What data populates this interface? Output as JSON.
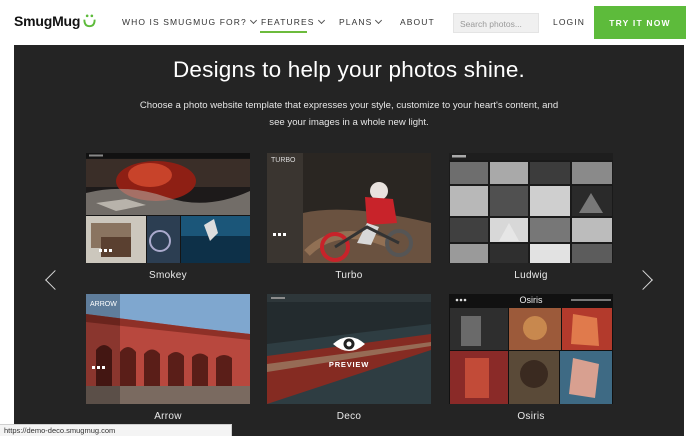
{
  "brand": {
    "name": "SmugMug",
    "accent": "#5dbb3b"
  },
  "nav": {
    "items": [
      {
        "label": "WHO IS SMUGMUG FOR?",
        "has_dropdown": true
      },
      {
        "label": "FEATURES",
        "has_dropdown": true,
        "active": true
      },
      {
        "label": "PLANS",
        "has_dropdown": true
      },
      {
        "label": "ABOUT",
        "has_dropdown": false
      }
    ],
    "search_placeholder": "Search photos...",
    "login": "LOGIN",
    "cta": "TRY IT NOW"
  },
  "hero": {
    "title": "Designs to help your photos shine.",
    "subtitle": "Choose a photo website template that expresses your style, customize to your heart's content, and see your images in a whole new light."
  },
  "templates": [
    {
      "name": "Smokey"
    },
    {
      "name": "Turbo",
      "thumb_text": "TURBO"
    },
    {
      "name": "Ludwig"
    },
    {
      "name": "Arrow",
      "thumb_text": "ARROW"
    },
    {
      "name": "Deco",
      "thumb_text": "PREVIEW"
    },
    {
      "name": "Osiris",
      "thumb_text": "Osiris"
    }
  ],
  "status_url": "https://demo-deco.smugmug.com"
}
